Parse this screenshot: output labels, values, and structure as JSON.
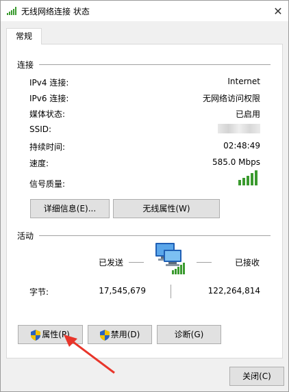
{
  "window": {
    "title": "无线网络连接 状态",
    "close_glyph": "✕"
  },
  "tabs": [
    {
      "label": "常规"
    }
  ],
  "connection": {
    "section_label": "连接",
    "rows": [
      {
        "label": "IPv4 连接:",
        "value": "Internet"
      },
      {
        "label": "IPv6 连接:",
        "value": "无网络访问权限"
      },
      {
        "label": "媒体状态:",
        "value": "已启用"
      },
      {
        "label": "SSID:",
        "value": ""
      },
      {
        "label": "持续时间:",
        "value": "02:48:49"
      },
      {
        "label": "速度:",
        "value": "585.0 Mbps"
      }
    ],
    "signal_label": "信号质量:",
    "signal_bars": 5,
    "details_button": "详细信息(E)...",
    "wireless_props_button": "无线属性(W)"
  },
  "activity": {
    "section_label": "活动",
    "sent_label": "已发送",
    "received_label": "已接收",
    "bytes_label": "字节:",
    "bytes_sent": "17,545,679",
    "bytes_received": "122,264,814"
  },
  "actions": {
    "properties_button": "属性(P)",
    "disable_button": "禁用(D)",
    "diagnose_button": "诊断(G)"
  },
  "footer": {
    "close_button": "关闭(C)"
  },
  "colors": {
    "signal_green": "#3a9a2e",
    "annotation_arrow": "#e8352a",
    "shield_blue": "#2a62c0",
    "shield_yellow": "#f2c200"
  }
}
